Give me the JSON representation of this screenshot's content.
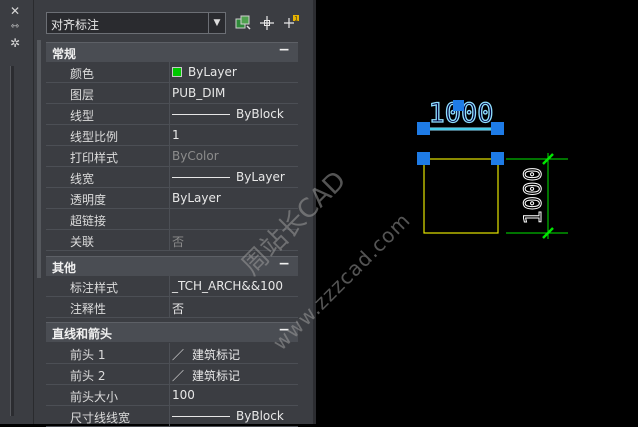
{
  "selector": {
    "value": "对齐标注"
  },
  "sections": {
    "general": {
      "title": "常规",
      "collapse": "−"
    },
    "other": {
      "title": "其他",
      "collapse": "−"
    },
    "lines": {
      "title": "直线和箭头",
      "collapse": "−"
    }
  },
  "general": [
    {
      "key": "颜色",
      "value": "ByLayer"
    },
    {
      "key": "图层",
      "value": "PUB_DIM"
    },
    {
      "key": "线型",
      "value": "ByBlock"
    },
    {
      "key": "线型比例",
      "value": "1"
    },
    {
      "key": "打印样式",
      "value": "ByColor"
    },
    {
      "key": "线宽",
      "value": "ByLayer"
    },
    {
      "key": "透明度",
      "value": "ByLayer"
    },
    {
      "key": "超链接",
      "value": ""
    },
    {
      "key": "关联",
      "value": "否"
    }
  ],
  "other": [
    {
      "key": "标注样式",
      "value": "_TCH_ARCH&&100"
    },
    {
      "key": "注释性",
      "value": "否"
    }
  ],
  "lines": [
    {
      "key": "前头 1",
      "value": "建筑标记"
    },
    {
      "key": "前头 2",
      "value": "建筑标记"
    },
    {
      "key": "前头大小",
      "value": "100"
    },
    {
      "key": "尺寸线线宽",
      "value": "ByBlock"
    }
  ],
  "drawing": {
    "dim_top": "1000",
    "dim_right": "1000"
  },
  "watermark": {
    "line1": "周站长CAD",
    "line2": "www.zzzcad.com"
  },
  "colors": {
    "dim": "#00e600",
    "grip": "#1e7be6",
    "rect": "#e6e600",
    "highlight": "#8fe0ff",
    "swatch": "#00c800"
  },
  "icons": [
    "close-icon",
    "pin-icon",
    "settings-icon",
    "quick-select-icon",
    "pick-icon",
    "toggle-pickadd-icon"
  ]
}
